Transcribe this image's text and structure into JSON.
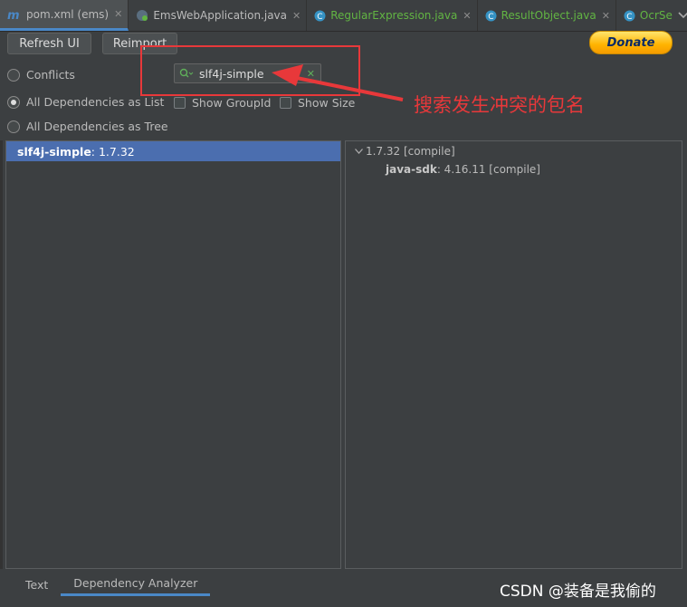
{
  "tabs": [
    {
      "label": "pom.xml (ems)",
      "icon": "maven-icon",
      "active": true
    },
    {
      "label": "EmsWebApplication.java",
      "icon": "spring-boot-app-icon",
      "active": false
    },
    {
      "label": "RegularExpression.java",
      "icon": "java-class-icon",
      "active": false
    },
    {
      "label": "ResultObject.java",
      "icon": "java-class-icon",
      "active": false
    },
    {
      "label": "OcrSe",
      "icon": "java-class-icon",
      "active": false
    }
  ],
  "toolbar": {
    "refresh_label": "Refresh UI",
    "reimport_label": "Reimport",
    "donate_label": "Donate"
  },
  "options": {
    "conflicts_label": "Conflicts",
    "list_label": "All Dependencies as List",
    "tree_label": "All Dependencies as Tree",
    "show_groupid_label": "Show GroupId",
    "show_size_label": "Show Size",
    "selected": "All Dependencies as List"
  },
  "search": {
    "value": "slf4j-simple"
  },
  "annotation": {
    "text": "搜索发生冲突的包名",
    "color": "#e8383a"
  },
  "left_list": [
    {
      "name": "slf4j-simple",
      "version": " : 1.7.32"
    }
  ],
  "right_tree": {
    "root": "1.7.32 [compile]",
    "children": [
      {
        "name": "java-sdk",
        "detail": " : 4.16.11 [compile]"
      }
    ]
  },
  "bottom_tabs": {
    "text_label": "Text",
    "analyzer_label": "Dependency Analyzer"
  },
  "watermark": "CSDN @装备是我偷的",
  "colors": {
    "background": "#3c3f41",
    "selection": "#4b6eaf",
    "accent": "#4a88c7",
    "java_file": "#62b543"
  }
}
